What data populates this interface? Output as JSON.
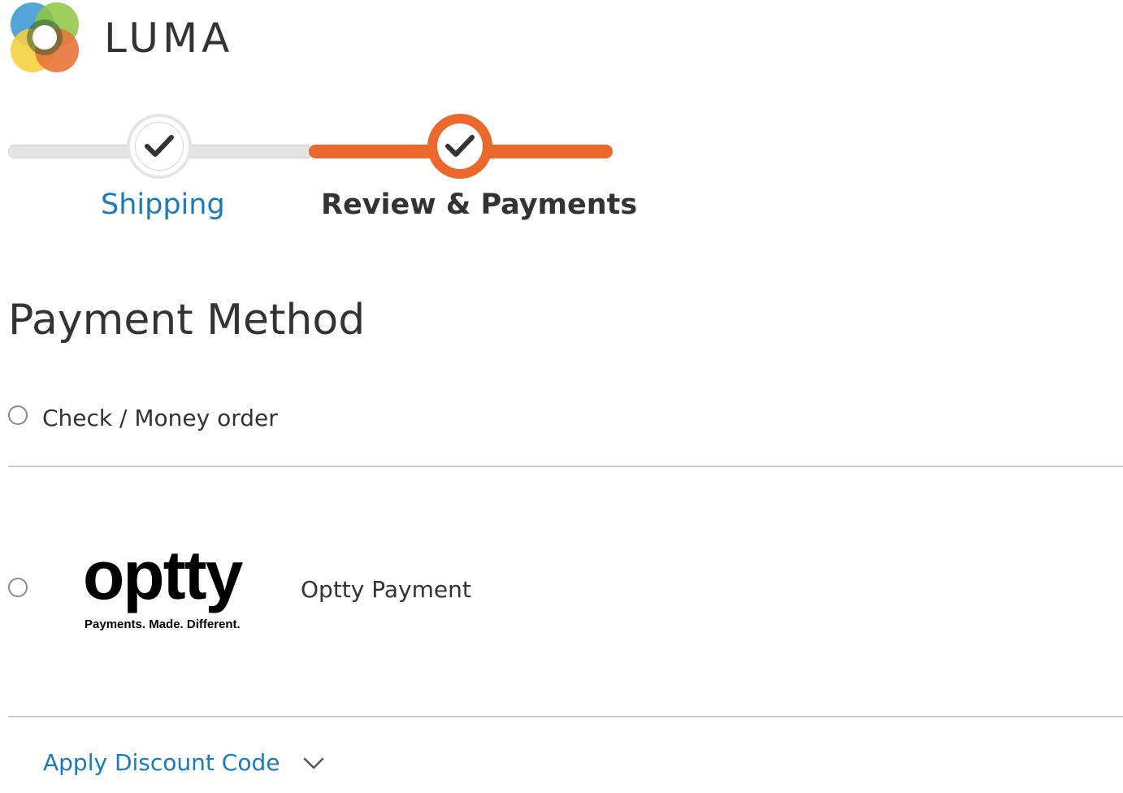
{
  "brand": {
    "name": "LUMA",
    "logo_colors": [
      "#4ba1d6",
      "#8dc63f",
      "#f4d03f",
      "#e8743b",
      "#2c5f2d"
    ]
  },
  "progress": {
    "steps": [
      {
        "label": "Shipping",
        "state": "completed",
        "icon": "check-icon"
      },
      {
        "label": "Review & Payments",
        "state": "active",
        "icon": "check-icon"
      }
    ],
    "accent_color": "#ec672c",
    "inactive_color": "#e4e4e4"
  },
  "payment": {
    "title": "Payment Method",
    "methods": [
      {
        "label": "Check / Money order",
        "selected": false
      },
      {
        "label": "Optty Payment",
        "selected": false,
        "logo_word": "optty",
        "logo_tagline": "Payments. Made. Different."
      }
    ]
  },
  "discount": {
    "label": "Apply Discount Code",
    "icon": "chevron-down-icon",
    "expanded": false
  },
  "colors": {
    "link": "#1979c3",
    "text": "#333333",
    "divider": "#cccccc"
  }
}
